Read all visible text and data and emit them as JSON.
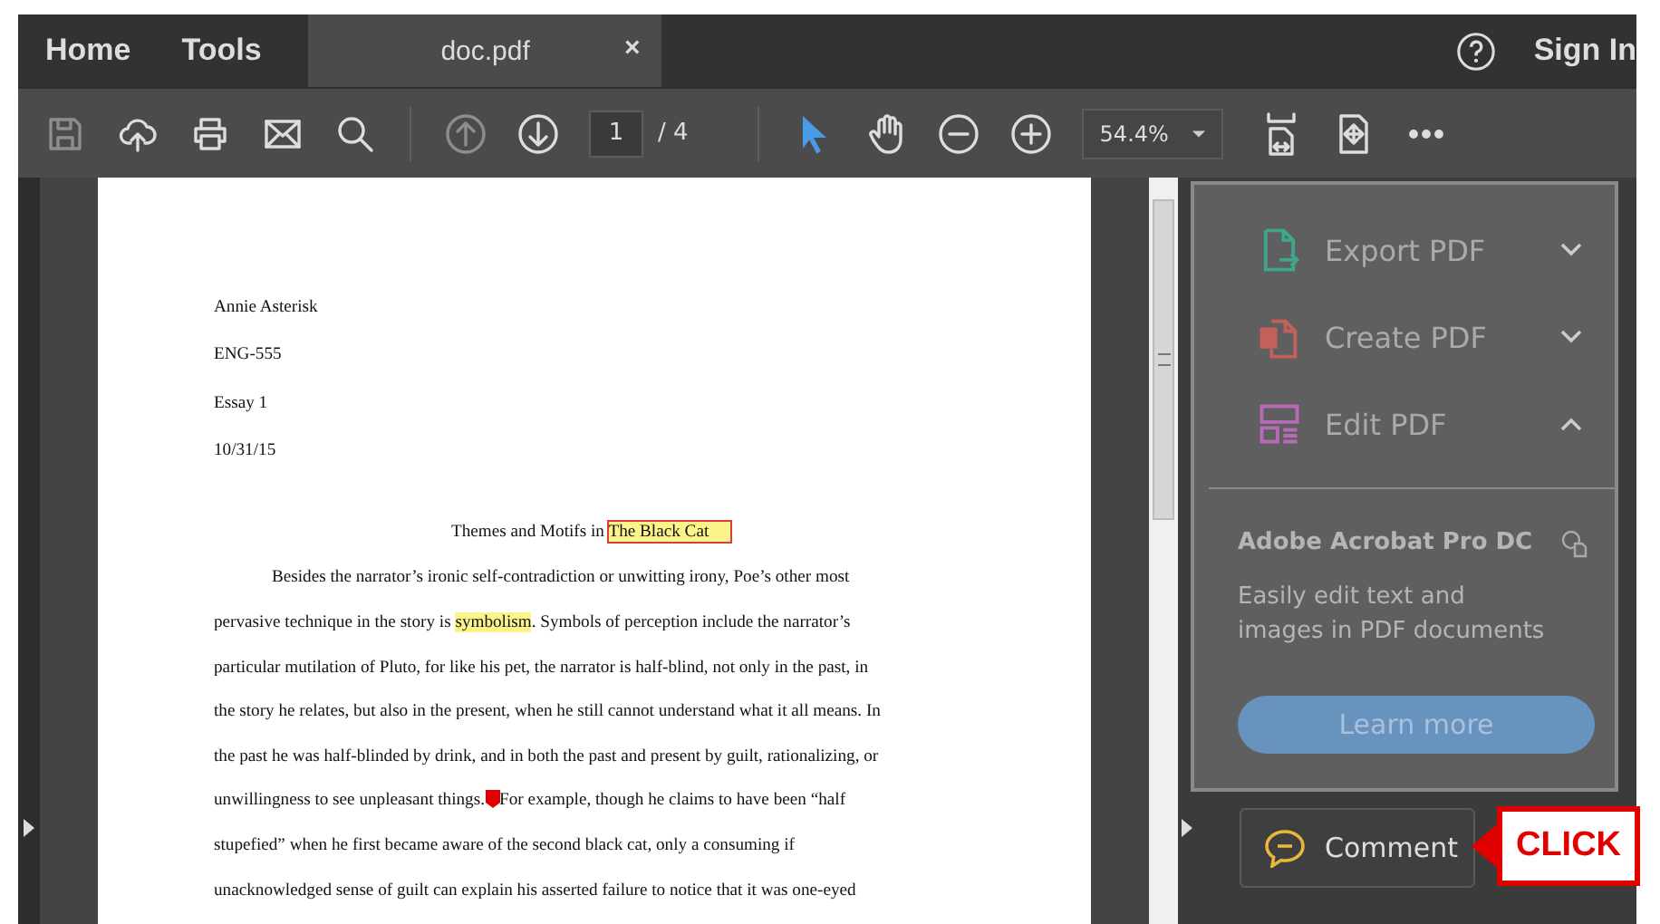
{
  "top_tabs": [
    {
      "label": "Home",
      "selected": false
    },
    {
      "label": "Tools",
      "selected": false
    }
  ],
  "document_tab": {
    "title": "doc.pdf",
    "close": "×",
    "selected": true
  },
  "account": {
    "label": "Sign In"
  },
  "toolbar": {
    "groups": [
      {
        "buttons": [
          {
            "kind": "save",
            "disabled": true,
            "selected": false
          },
          {
            "kind": "upload",
            "disabled": false,
            "selected": false
          },
          {
            "kind": "print",
            "disabled": false,
            "selected": false
          },
          {
            "kind": "mail",
            "disabled": false,
            "selected": false
          },
          {
            "kind": "search",
            "disabled": false,
            "selected": false
          }
        ]
      },
      {
        "buttons": [
          {
            "kind": "prev",
            "disabled": true,
            "selected": false
          },
          {
            "kind": "next",
            "disabled": false,
            "selected": false
          }
        ]
      },
      {
        "buttons": [
          {
            "kind": "pointer",
            "disabled": false,
            "selected": true
          },
          {
            "kind": "hand",
            "disabled": false,
            "selected": false
          },
          {
            "kind": "zoomout",
            "disabled": false,
            "selected": false
          },
          {
            "kind": "zoomin",
            "disabled": false,
            "selected": false
          }
        ]
      },
      {
        "buttons": [
          {
            "kind": "fitwidth",
            "disabled": false,
            "selected": false
          },
          {
            "kind": "fitpage",
            "disabled": false,
            "selected": false
          },
          {
            "kind": "more",
            "disabled": false,
            "selected": false
          }
        ]
      }
    ]
  },
  "page_field": {
    "value": "1",
    "total": "/ 4"
  },
  "zoom_field": {
    "value": "54.4%"
  },
  "document": {
    "header": [
      "Annie Asterisk",
      "ENG-555",
      "Essay 1",
      "10/31/15"
    ],
    "title": {
      "text": "Themes and Motifs in ",
      "annotated": "The Black Cat"
    },
    "lines": [
      {
        "kind": "indent",
        "text": "Besides the narrator’s ironic self-contradiction or unwitting irony, Poe’s other most"
      },
      {
        "kind": "highlight",
        "text": "pervasive technique in the story is ",
        "marked": "symbolism",
        "after": ". Symbols of perception include the narrator’s"
      },
      {
        "kind": "plain",
        "text": "particular mutilation of Pluto, for like his pet, the narrator is half-blind, not only in the past, in"
      },
      {
        "kind": "plain",
        "text": "the story he relates, but also in the present, when he still cannot understand what it all means. In"
      },
      {
        "kind": "plain",
        "text": "the past he was half-blinded by drink, and in both the past and present by guilt, rationalizing, or"
      },
      {
        "kind": "comment",
        "text": "unwillingness to see unpleasant things.",
        "after": "For example, though he claims to have been “half"
      },
      {
        "kind": "plain",
        "text": "stupefied” when he first became aware of the second black cat, only a consuming if"
      },
      {
        "kind": "plain",
        "text": "unacknowledged sense of guilt can explain his asserted failure to notice that it was one-eyed"
      }
    ]
  },
  "tools_panel": {
    "items": [
      {
        "kind": "export",
        "label": "Export PDF",
        "expanded": false,
        "color": "#3fa58d"
      },
      {
        "kind": "create",
        "label": "Create PDF",
        "expanded": false,
        "color": "#c4605a"
      },
      {
        "kind": "edit",
        "label": "Edit PDF",
        "expanded": true,
        "color": "#b66ab8"
      }
    ],
    "promo": {
      "title": "Adobe Acrobat Pro DC",
      "description": "Easily edit text and images in PDF documents",
      "button": "Learn more"
    }
  },
  "comment_button": {
    "label": "Comment"
  },
  "callout": {
    "label": "CLICK"
  }
}
